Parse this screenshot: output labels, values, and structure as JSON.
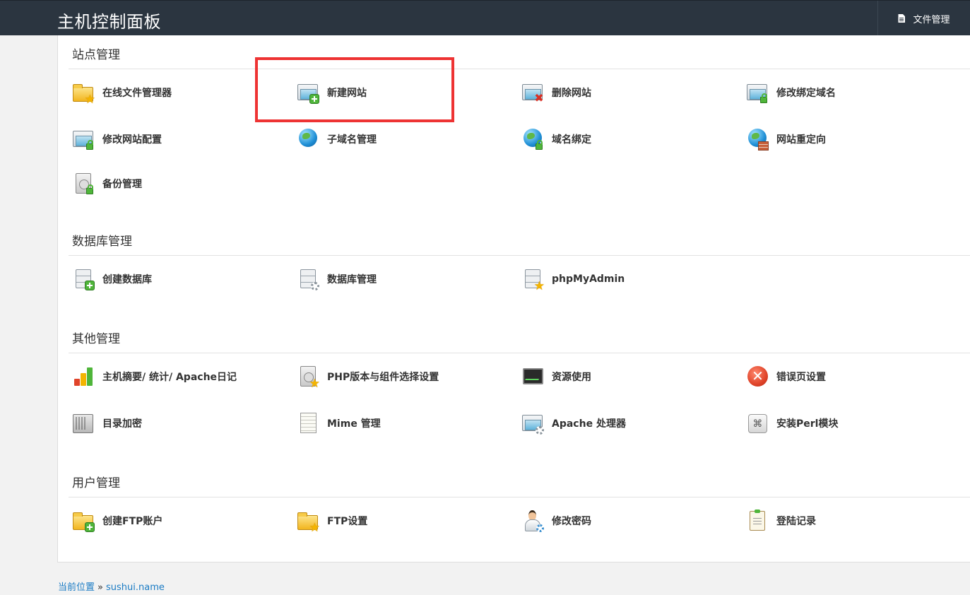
{
  "header": {
    "title": "主机控制面板",
    "file_manager_label": "文件管理"
  },
  "sections": {
    "site": {
      "title": "站点管理",
      "items": [
        {
          "label": "在线文件管理器",
          "icon": "folder-star-icon"
        },
        {
          "label": "新建网站",
          "icon": "window-add-icon"
        },
        {
          "label": "删除网站",
          "icon": "window-delete-icon"
        },
        {
          "label": "修改绑定域名",
          "icon": "window-lock-icon"
        },
        {
          "label": "修改网站配置",
          "icon": "window-config-icon"
        },
        {
          "label": "子域名管理",
          "icon": "globe-hand-icon"
        },
        {
          "label": "域名绑定",
          "icon": "globe-lock-icon"
        },
        {
          "label": "网站重定向",
          "icon": "globe-wall-icon"
        },
        {
          "label": "备份管理",
          "icon": "disk-backup-icon"
        }
      ]
    },
    "database": {
      "title": "数据库管理",
      "items": [
        {
          "label": "创建数据库",
          "icon": "database-add-icon"
        },
        {
          "label": "数据库管理",
          "icon": "database-gear-icon"
        },
        {
          "label": "phpMyAdmin",
          "icon": "database-star-icon"
        }
      ]
    },
    "other": {
      "title": "其他管理",
      "items": [
        {
          "label": "主机摘要/ 统计/ Apache日记",
          "icon": "bar-chart-icon"
        },
        {
          "label": "PHP版本与组件选择设置",
          "icon": "disk-star-icon"
        },
        {
          "label": "资源使用",
          "icon": "monitor-pulse-icon"
        },
        {
          "label": "错误页设置",
          "icon": "error-x-icon"
        },
        {
          "label": "目录加密",
          "icon": "safe-icon"
        },
        {
          "label": "Mime 管理",
          "icon": "document-icon"
        },
        {
          "label": "Apache 处理器",
          "icon": "window-gear-icon"
        },
        {
          "label": "安装Perl模块",
          "icon": "command-key-icon"
        }
      ]
    },
    "user": {
      "title": "用户管理",
      "items": [
        {
          "label": "创建FTP账户",
          "icon": "folder-add-icon"
        },
        {
          "label": "FTP设置",
          "icon": "folder-star-icon"
        },
        {
          "label": "修改密码",
          "icon": "user-settings-icon"
        },
        {
          "label": "登陆记录",
          "icon": "clipboard-icon"
        }
      ]
    }
  },
  "breadcrumb": {
    "current_label": "当前位置",
    "separator": "»",
    "site": "sushui.name"
  },
  "colors": {
    "topbar": "#2b3540",
    "highlight": "#ee3333",
    "link": "#1a7bc4"
  }
}
